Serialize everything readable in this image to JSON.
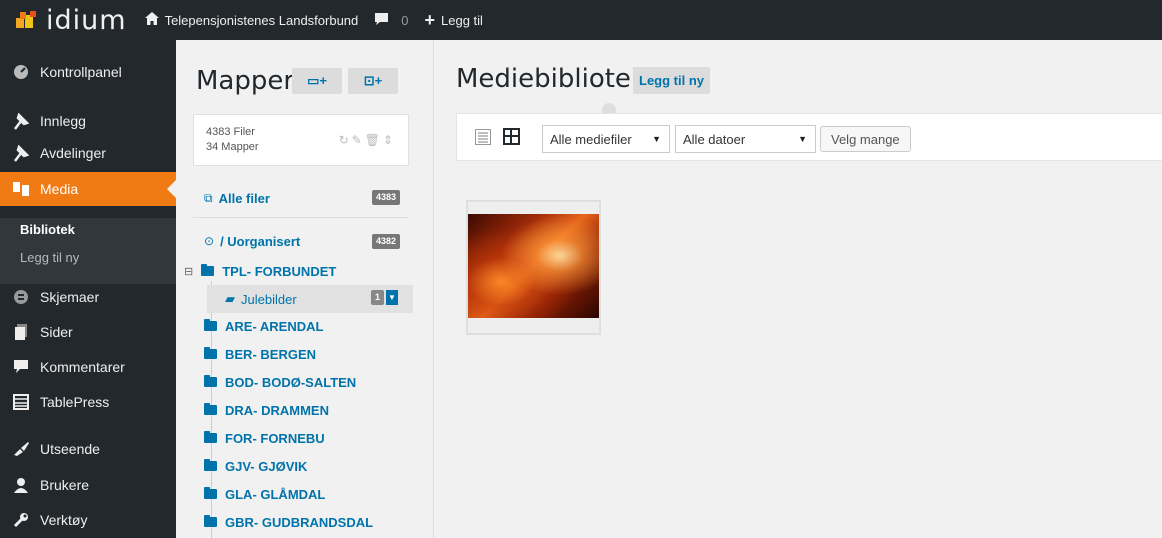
{
  "adminbar": {
    "logo_text": "idium",
    "site_name": "Telepensjonistenes Landsforbund",
    "comments_count": "0",
    "new_label": "Legg til"
  },
  "menu": {
    "items": [
      {
        "label": "Kontrollpanel",
        "icon": "dashboard-icon"
      },
      {
        "label": "Innlegg",
        "icon": "pin-icon"
      },
      {
        "label": "Avdelinger",
        "icon": "pin-icon"
      },
      {
        "label": "Media",
        "icon": "media-icon"
      },
      {
        "label": "Skjemaer",
        "icon": "forms-icon"
      },
      {
        "label": "Sider",
        "icon": "page-icon"
      },
      {
        "label": "Kommentarer",
        "icon": "comment-icon"
      },
      {
        "label": "TablePress",
        "icon": "table-icon"
      },
      {
        "label": "Utseende",
        "icon": "brush-icon"
      },
      {
        "label": "Brukere",
        "icon": "user-icon"
      },
      {
        "label": "Verktøy",
        "icon": "wrench-icon"
      }
    ],
    "submenu": {
      "current": "Bibliotek",
      "add_new": "Legg til ny"
    }
  },
  "folders": {
    "title": "Mapper",
    "files_count": "4383 Filer",
    "folders_count": "34 Mapper",
    "all_files": {
      "label": "Alle filer",
      "count": "4383"
    },
    "unorganized": {
      "label": "/ Uorganisert",
      "count": "4382"
    },
    "tree": [
      {
        "label": "TPL- FORBUNDET"
      },
      {
        "label": "Julebilder",
        "count": "1"
      },
      {
        "label": "ARE- ARENDAL"
      },
      {
        "label": "BER- BERGEN"
      },
      {
        "label": "BOD- BODØ-SALTEN"
      },
      {
        "label": "DRA- DRAMMEN"
      },
      {
        "label": "FOR- FORNEBU"
      },
      {
        "label": "GJV- GJØVIK"
      },
      {
        "label": "GLA- GLÅMDAL"
      },
      {
        "label": "GBR- GUDBRANDSDAL"
      }
    ]
  },
  "main": {
    "title": "Mediebibliotek",
    "add_new": "Legg til ny",
    "filter_type": "Alle mediefiler",
    "filter_date": "Alle datoer",
    "bulk_select": "Velg mange"
  },
  "colors": {
    "accent": "#f07b15",
    "link": "#0073aa",
    "admin_bg": "#23282d"
  }
}
